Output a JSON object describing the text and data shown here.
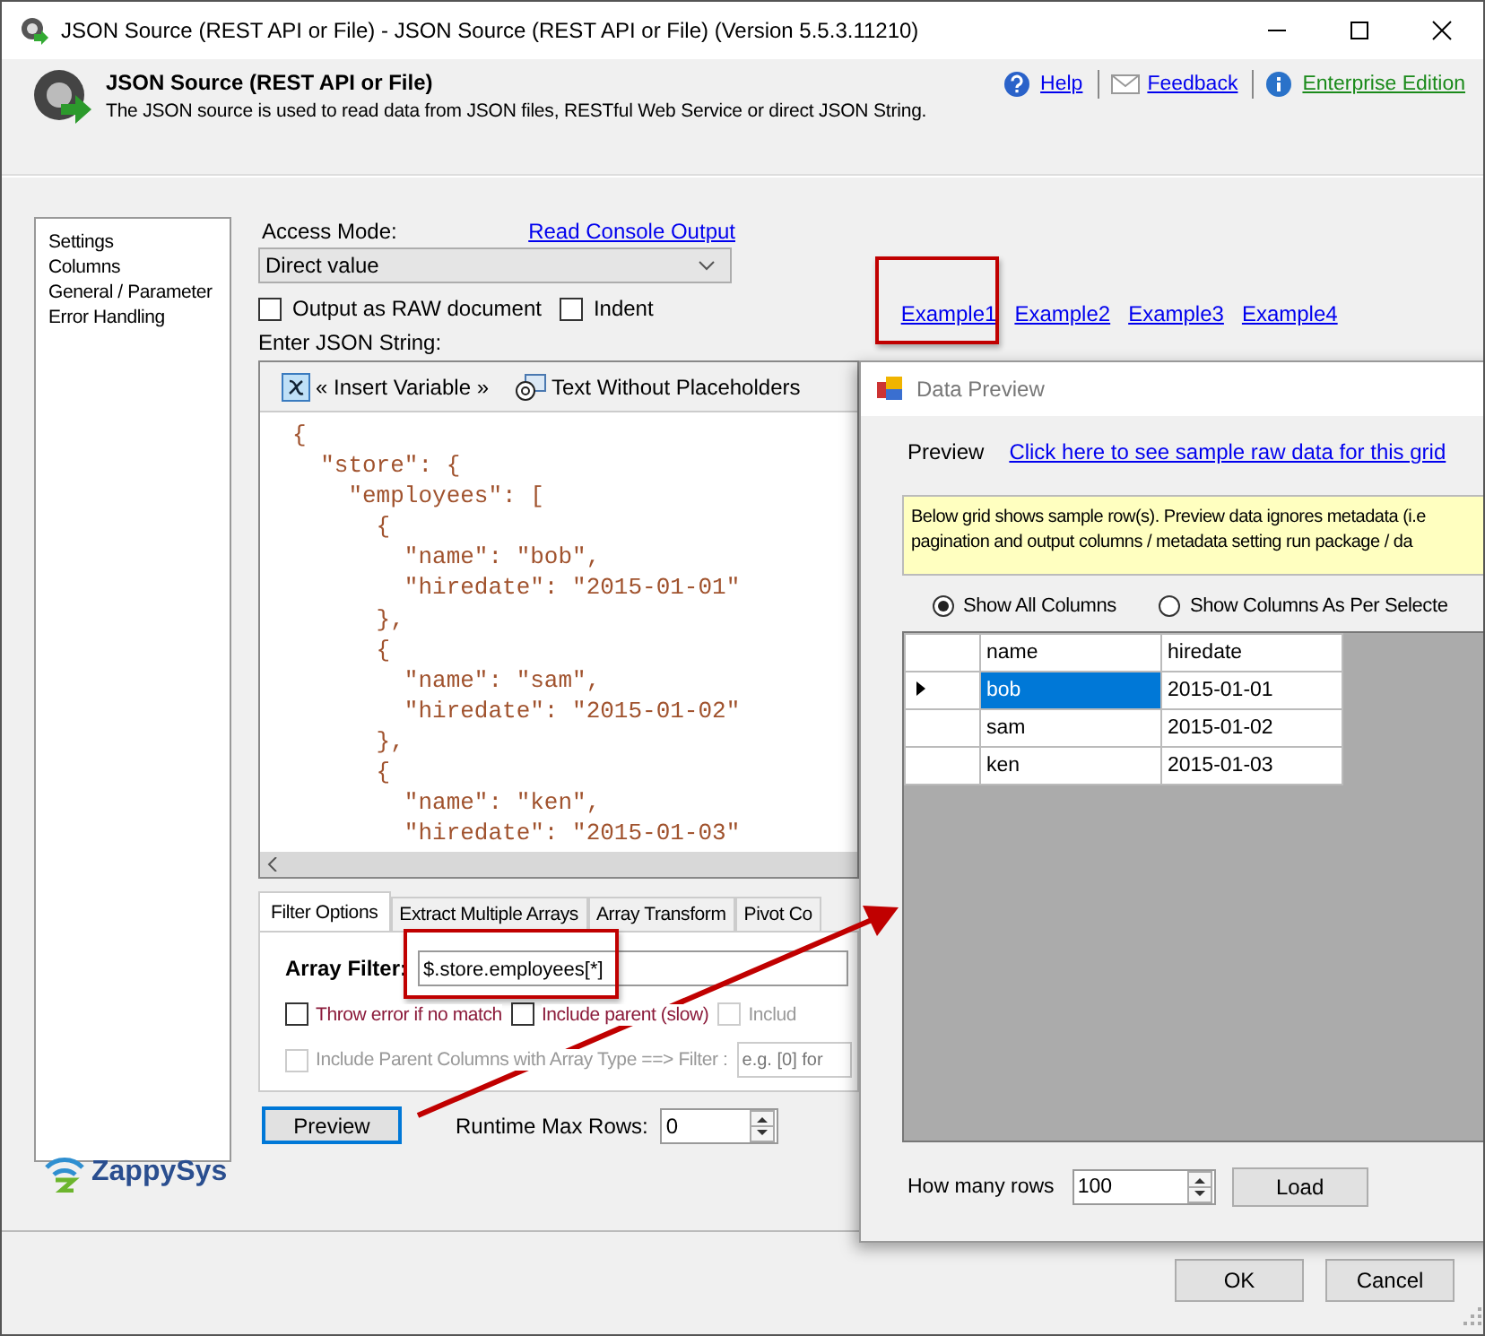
{
  "window": {
    "title": "JSON Source (REST API or File) - JSON Source (REST API or File) (Version 5.5.3.11210)"
  },
  "header": {
    "title": "JSON Source (REST API or File)",
    "description": "The JSON source is used to read data from JSON files, RESTful Web Service or direct JSON String.",
    "links": [
      {
        "label": "Help",
        "kind": "help"
      },
      {
        "label": "Feedback",
        "kind": "feedback"
      },
      {
        "label": "Enterprise Edition",
        "kind": "edition"
      }
    ]
  },
  "sidebar": {
    "items": [
      {
        "label": "Settings",
        "selected": false
      },
      {
        "label": "Columns",
        "selected": false
      },
      {
        "label": "General / Parameter",
        "selected": false
      },
      {
        "label": "Error Handling",
        "selected": false
      }
    ]
  },
  "settings": {
    "access_mode_label": "Access Mode:",
    "console_link": "Read Console Output",
    "access_mode": "Direct value",
    "checkboxes": [
      {
        "label": "Output as RAW document",
        "checked": false
      },
      {
        "label": "Indent",
        "checked": false
      }
    ],
    "examples": [
      {
        "label": "Example1",
        "highlighted": true
      },
      {
        "label": "Example2",
        "highlighted": false
      },
      {
        "label": "Example3",
        "highlighted": false
      },
      {
        "label": "Example4",
        "highlighted": false
      }
    ],
    "json_label": "Enter JSON String:",
    "toolbar": [
      {
        "label": "« Insert Variable »",
        "kind": "variable"
      },
      {
        "label": "Text Without Placeholders",
        "kind": "at"
      }
    ],
    "code_lines": [
      "{",
      "  \"store\": {",
      "    \"employees\": [",
      "      {",
      "        \"name\": \"bob\",",
      "        \"hiredate\": \"2015-01-01\"",
      "      },",
      "      {",
      "        \"name\": \"sam\",",
      "        \"hiredate\": \"2015-01-02\"",
      "      },",
      "      {",
      "        \"name\": \"ken\",",
      "        \"hiredate\": \"2015-01-03\""
    ]
  },
  "filter": {
    "tabs": [
      {
        "label": "Filter Options",
        "selected": true
      },
      {
        "label": "Extract Multiple Arrays",
        "selected": false
      },
      {
        "label": "Array Transform",
        "selected": false
      },
      {
        "label": "Pivot Co",
        "selected": false
      }
    ],
    "array_filter_label": "Array Filter:",
    "array_filter": "$.store.employees[*]",
    "array_filter_highlighted": true,
    "options": [
      {
        "label": "Throw error if no match",
        "checked": false,
        "disabled": false
      },
      {
        "label": "Include parent (slow)",
        "checked": false,
        "disabled": false
      },
      {
        "label": "Includ",
        "checked": false,
        "disabled": true
      }
    ],
    "parent_columns": {
      "label": "Include Parent Columns with Array Type ==> Filter :",
      "checked": false,
      "disabled": true,
      "placeholder": "e.g. [0] for"
    }
  },
  "preview_button": "Preview",
  "max_rows_label": "Runtime Max Rows:",
  "max_rows": "0",
  "logo": "ZappySys",
  "dialog": {
    "title": "Data Preview",
    "preview_label": "Preview",
    "raw_link": "Click here to see sample raw data for this grid",
    "notice": [
      "Below grid shows sample row(s). Preview data ignores metadata (i.e",
      "pagination and output columns / metadata setting run package / da"
    ],
    "radios": [
      {
        "label": "Show All Columns",
        "selected": true
      },
      {
        "label": "Show Columns As Per Selecte",
        "selected": false
      }
    ],
    "columns": [
      "name",
      "hiredate"
    ],
    "rows": [
      {
        "cells": [
          "bob",
          "2015-01-01"
        ],
        "selected": true
      },
      {
        "cells": [
          "sam",
          "2015-01-02"
        ],
        "selected": false
      },
      {
        "cells": [
          "ken",
          "2015-01-03"
        ],
        "selected": false
      }
    ],
    "rows_label": "How many rows",
    "rows_value": "100",
    "load_button": "Load"
  },
  "buttons": [
    "OK",
    "Cancel"
  ]
}
